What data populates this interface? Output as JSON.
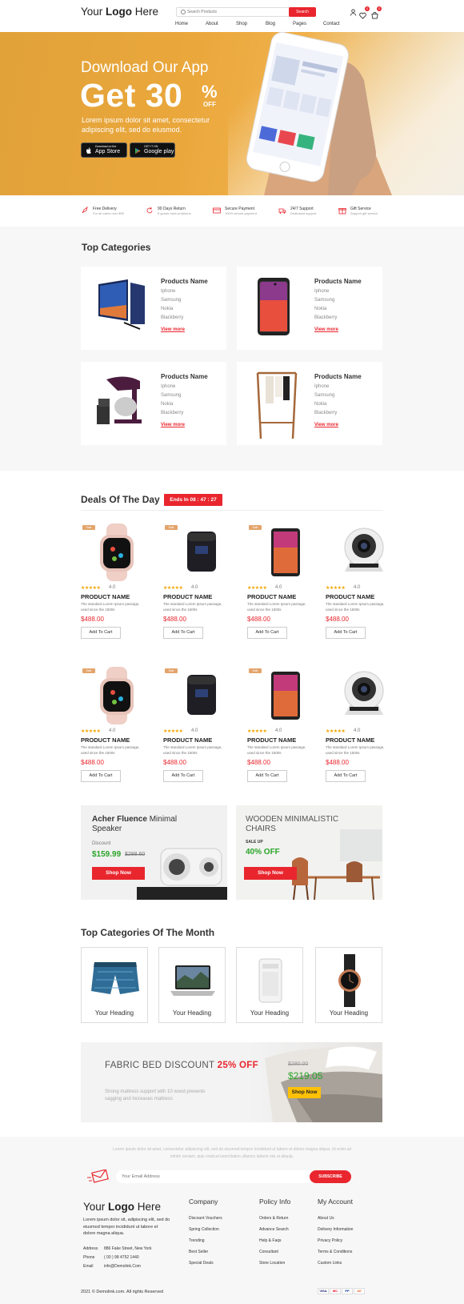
{
  "header": {
    "logo": {
      "pre": "Your ",
      "bold": "Logo",
      "post": " Here"
    },
    "search_placeholder": "Search Products",
    "search_button": "Search",
    "cart_badge": "0",
    "wishlist_badge": "0",
    "nav": [
      "Home",
      "About",
      "Shop",
      "Blog",
      "Pages",
      "Contact"
    ]
  },
  "hero": {
    "subtitle": "Download Our App",
    "headline": "Get 30",
    "percent": "%",
    "off": "OFF",
    "description": "Lorem ipsum dolor sit amet, consectetur adipiscing elit, sed do eiusmod.",
    "app_store": {
      "small": "Download on the",
      "big": "App Store"
    },
    "google_play": {
      "small": "GET IT ON",
      "big": "Google play"
    }
  },
  "features": [
    {
      "title": "Free Delivery",
      "sub": "For all oders over $99"
    },
    {
      "title": "90 Days Return",
      "sub": "If goods have problems"
    },
    {
      "title": "Secure Payment",
      "sub": "100% secure payment"
    },
    {
      "title": "24/7 Support",
      "sub": "Dedicated support"
    },
    {
      "title": "Gift Service",
      "sub": "Support gift service"
    }
  ],
  "top_categories": {
    "title": "Top Categories",
    "cards": [
      {
        "name": "Products Name",
        "items": [
          "Iphone",
          "Samsung",
          "Nokia",
          "Blackberry"
        ],
        "link": "View more"
      },
      {
        "name": "Products Name",
        "items": [
          "Iphone",
          "Samsung",
          "Nokia",
          "Blackberry"
        ],
        "link": "View more"
      },
      {
        "name": "Products Name",
        "items": [
          "Iphone",
          "Samsung",
          "Nokia",
          "Blackberry"
        ],
        "link": "View more"
      },
      {
        "name": "Products Name",
        "items": [
          "Iphone",
          "Samsung",
          "Nokia",
          "Blackberry"
        ],
        "link": "View more"
      }
    ]
  },
  "deals": {
    "title": "Deals Of The Day",
    "timer": "Ends In  08 : 47 : 27",
    "products": [
      {
        "tag": "Sale",
        "stars": "★★★★★",
        "rating": "4.0",
        "name": "PRODUCT NAME",
        "desc": "The standard Lorem Ipsum passage, used since the 1500s",
        "price": "$488.00",
        "button": "Add To Cart"
      },
      {
        "tag": "Sale",
        "stars": "★★★★★",
        "rating": "4.0",
        "name": "PRODUCT NAME",
        "desc": "The standard Lorem Ipsum passage, used since the 1500s",
        "price": "$488.00",
        "button": "Add To Cart"
      },
      {
        "tag": "Sale",
        "stars": "★★★★★",
        "rating": "4.0",
        "name": "PRODUCT NAME",
        "desc": "The standard Lorem Ipsum passage, used since the 1500s",
        "price": "$488.00",
        "button": "Add To Cart"
      },
      {
        "tag": "",
        "stars": "★★★★★",
        "rating": "4.0",
        "name": "PRODUCT NAME",
        "desc": "The standard Lorem Ipsum passage, used since the 1500s",
        "price": "$488.00",
        "button": "Add To Cart"
      },
      {
        "tag": "Sale",
        "stars": "★★★★★",
        "rating": "4.0",
        "name": "PRODUCT NAME",
        "desc": "The standard Lorem Ipsum passage, used since the 1500s",
        "price": "$488.00",
        "button": "Add To Cart"
      },
      {
        "tag": "Sale",
        "stars": "★★★★★",
        "rating": "4.0",
        "name": "PRODUCT NAME",
        "desc": "The standard Lorem Ipsum passage, used since the 1500s",
        "price": "$488.00",
        "button": "Add To Cart"
      },
      {
        "tag": "Sale",
        "stars": "★★★★★",
        "rating": "4.0",
        "name": "PRODUCT NAME",
        "desc": "The standard Lorem Ipsum passage, used since the 1500s",
        "price": "$488.00",
        "button": "Add To Cart"
      },
      {
        "tag": "",
        "stars": "★★★★★",
        "rating": "4.0",
        "name": "PRODUCT NAME",
        "desc": "The standard Lorem Ipsum passage, used since the 1500s",
        "price": "$488.00",
        "button": "Add To Cart"
      }
    ]
  },
  "promos": [
    {
      "title_bold": "Acher Fluence",
      "title_rest": " Minimal Speaker",
      "label": "Discount",
      "price": "$159.99",
      "old_price": "$288.60",
      "button": "Shop Now"
    },
    {
      "title": "WOODEN MINIMALISTIC CHAIRS",
      "label": "SALE UP",
      "percent": "40% OFF",
      "button": "Shop Now"
    }
  ],
  "month_categories": {
    "title": "Top Categories Of The Month",
    "items": [
      "Your Heading",
      "Your Heading",
      "Your Heading",
      "Your Heading"
    ]
  },
  "fabric": {
    "title": "FABRIC BED DISCOUNT ",
    "percent": "25% OFF",
    "desc": "Strong mattress support with 10 wood prevents sagging and increases mattress",
    "old_price": "$280.00",
    "price": "$219.05",
    "button": "Shop Now"
  },
  "newsletter": {
    "text": "Lorem ipsum dolor sit amet, consectetur adipiscing elit, sed do eiusmod tempor incididunt ut labore et dolore magna aliqua. Ut enim ad minim veniam, quis nostrud exercitation ullamco laboris nisi ut aliquip.",
    "placeholder": "Your Email Address",
    "button": "SUBSCRIBE"
  },
  "footer": {
    "logo": {
      "pre": "Your ",
      "bold": "Logo",
      "post": " Here"
    },
    "about": "Lorem ipsum dolor sit, adipiscing elit, sed do eiusmod tempor incididunt ut labore et dolore magna aliqua.",
    "contact": [
      {
        "k": "Address",
        "v": "886 Fake Street, New York"
      },
      {
        "k": "Phone",
        "v": "( 00 ) 98 4752 1440"
      },
      {
        "k": "Email",
        "v": "info@Demolink.Com"
      }
    ],
    "columns": [
      {
        "title": "Company",
        "links": [
          "Discount Vouchers",
          "Spring Collection",
          "Trending",
          "Best Seller",
          "Special Deals"
        ]
      },
      {
        "title": "Policy Info",
        "links": [
          "Orders & Return",
          "Advance Search",
          "Help & Faqs",
          "Consultant",
          "Store Location"
        ]
      },
      {
        "title": "My Account",
        "links": [
          "About Us",
          "Delivery Information",
          "Privacy Policy",
          "Terms & Conditions",
          "Custom Links"
        ]
      }
    ],
    "copyright": "2021 © Demolink.com. All rights Reserved",
    "payments": [
      "VISA",
      "MC",
      "PP",
      "AE"
    ]
  },
  "colors": {
    "accent": "#e9262e",
    "hero": "#e8a53b",
    "green": "#2aa52a"
  }
}
